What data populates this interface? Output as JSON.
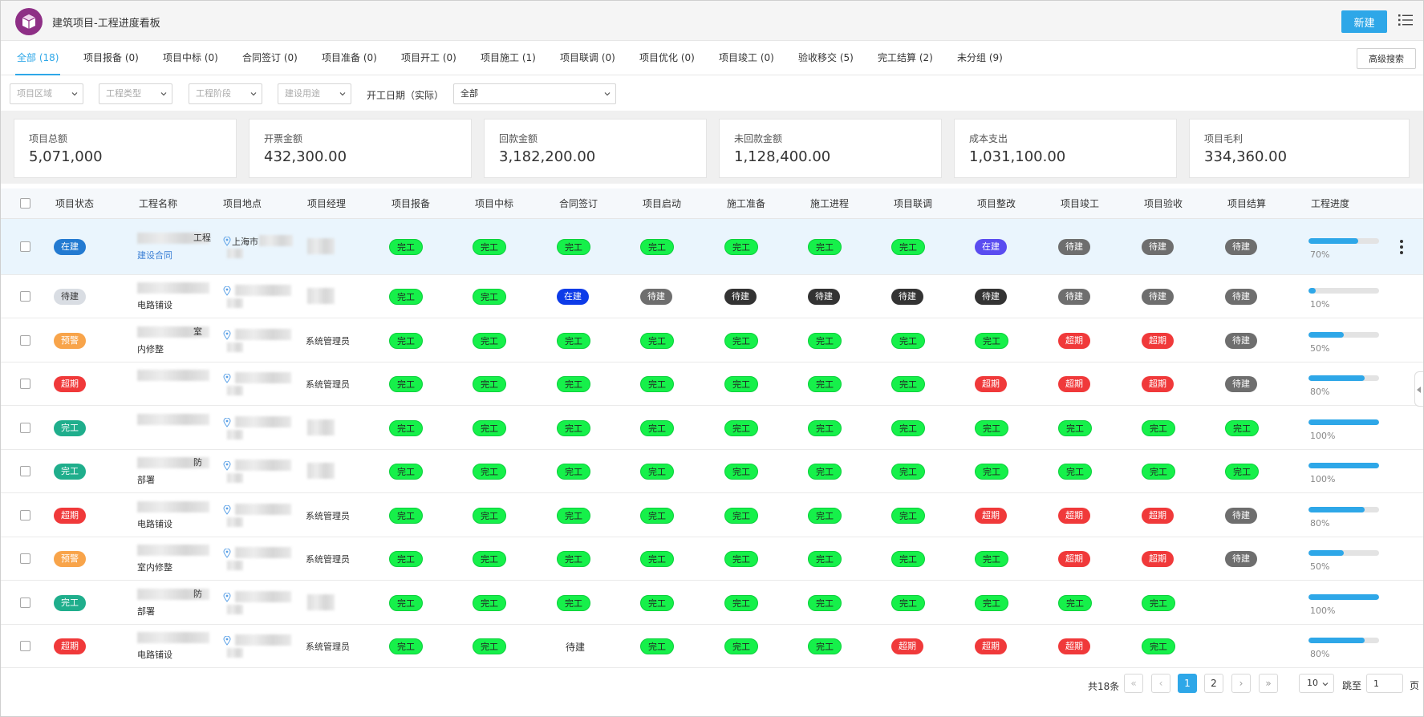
{
  "app": {
    "title": "建筑项目-工程进度看板",
    "new_label": "新建"
  },
  "tabs": [
    {
      "label": "全部 (18)",
      "active": true
    },
    {
      "label": "项目报备 (0)"
    },
    {
      "label": "项目中标 (0)"
    },
    {
      "label": "合同签订 (0)"
    },
    {
      "label": "项目准备 (0)"
    },
    {
      "label": "项目开工 (0)"
    },
    {
      "label": "项目施工 (1)"
    },
    {
      "label": "项目联调 (0)"
    },
    {
      "label": "项目优化 (0)"
    },
    {
      "label": "项目竣工 (0)"
    },
    {
      "label": "验收移交 (5)"
    },
    {
      "label": "完工结算 (2)"
    },
    {
      "label": "未分组 (9)"
    }
  ],
  "advanced_search": "高级搜索",
  "filters": {
    "region": "项目区域",
    "type": "工程类型",
    "stage": "工程阶段",
    "usage": "建设用途",
    "date_label": "开工日期（实际）",
    "date_value": "全部"
  },
  "stats": [
    {
      "label": "项目总额",
      "value": "5,071,000"
    },
    {
      "label": "开票金额",
      "value": "432,300.00"
    },
    {
      "label": "回款金额",
      "value": "3,182,200.00"
    },
    {
      "label": "未回款金额",
      "value": "1,128,400.00"
    },
    {
      "label": "成本支出",
      "value": "1,031,100.00"
    },
    {
      "label": "项目毛利",
      "value": "334,360.00"
    }
  ],
  "columns": [
    "项目状态",
    "工程名称",
    "项目地点",
    "项目经理",
    "项目报备",
    "项目中标",
    "合同签订",
    "项目启动",
    "施工准备",
    "施工进程",
    "项目联调",
    "项目整改",
    "项目竣工",
    "项目验收",
    "项目结算",
    "工程进度"
  ],
  "rows": [
    {
      "status": "在建",
      "status_color": "sblue",
      "name1": "工程",
      "name2": "建设合同",
      "name_link": true,
      "loc": "上海市",
      "mgr": "",
      "stages": [
        [
          "完工",
          "green"
        ],
        [
          "完工",
          "green"
        ],
        [
          "完工",
          "green"
        ],
        [
          "完工",
          "green"
        ],
        [
          "完工",
          "green"
        ],
        [
          "完工",
          "green"
        ],
        [
          "完工",
          "green"
        ],
        [
          "在建",
          "purple"
        ],
        [
          "待建",
          "grey"
        ],
        [
          "待建",
          "grey"
        ],
        [
          "待建",
          "grey"
        ]
      ],
      "progress": 70,
      "progress_label": "70%",
      "highlight": true
    },
    {
      "status": "待建",
      "status_color": "light",
      "name1": "",
      "name2": "电路铺设",
      "loc": "",
      "mgr": "",
      "stages": [
        [
          "完工",
          "green"
        ],
        [
          "完工",
          "green"
        ],
        [
          "在建",
          "blue"
        ],
        [
          "待建",
          "grey"
        ],
        [
          "待建",
          "dark"
        ],
        [
          "待建",
          "dark"
        ],
        [
          "待建",
          "dark"
        ],
        [
          "待建",
          "dark"
        ],
        [
          "待建",
          "grey"
        ],
        [
          "待建",
          "grey"
        ],
        [
          "待建",
          "grey"
        ]
      ],
      "progress": 10,
      "progress_label": "10%"
    },
    {
      "status": "预警",
      "status_color": "orange",
      "name1": "室",
      "name2": "内修整",
      "loc": "",
      "mgr": "系统管理员",
      "stages": [
        [
          "完工",
          "green"
        ],
        [
          "完工",
          "green"
        ],
        [
          "完工",
          "green"
        ],
        [
          "完工",
          "green"
        ],
        [
          "完工",
          "green"
        ],
        [
          "完工",
          "green"
        ],
        [
          "完工",
          "green"
        ],
        [
          "完工",
          "green"
        ],
        [
          "超期",
          "red"
        ],
        [
          "超期",
          "red"
        ],
        [
          "待建",
          "grey"
        ]
      ],
      "progress": 50,
      "progress_label": "50%"
    },
    {
      "status": "超期",
      "status_color": "red",
      "name1": "",
      "name2": "",
      "loc": "",
      "mgr": "系统管理员",
      "stages": [
        [
          "完工",
          "green"
        ],
        [
          "完工",
          "green"
        ],
        [
          "完工",
          "green"
        ],
        [
          "完工",
          "green"
        ],
        [
          "完工",
          "green"
        ],
        [
          "完工",
          "green"
        ],
        [
          "完工",
          "green"
        ],
        [
          "超期",
          "red"
        ],
        [
          "超期",
          "red"
        ],
        [
          "超期",
          "red"
        ],
        [
          "待建",
          "grey"
        ]
      ],
      "progress": 80,
      "progress_label": "80%"
    },
    {
      "status": "完工",
      "status_color": "teal",
      "name1": "",
      "name2": "",
      "loc": "",
      "mgr": "",
      "stages": [
        [
          "完工",
          "green"
        ],
        [
          "完工",
          "green"
        ],
        [
          "完工",
          "green"
        ],
        [
          "完工",
          "green"
        ],
        [
          "完工",
          "green"
        ],
        [
          "完工",
          "green"
        ],
        [
          "完工",
          "green"
        ],
        [
          "完工",
          "green"
        ],
        [
          "完工",
          "green"
        ],
        [
          "完工",
          "green"
        ],
        [
          "完工",
          "green"
        ]
      ],
      "progress": 100,
      "progress_label": "100%"
    },
    {
      "status": "完工",
      "status_color": "teal",
      "name1": "防",
      "name2": "部署",
      "loc": "",
      "mgr": "",
      "stages": [
        [
          "完工",
          "green"
        ],
        [
          "完工",
          "green"
        ],
        [
          "完工",
          "green"
        ],
        [
          "完工",
          "green"
        ],
        [
          "完工",
          "green"
        ],
        [
          "完工",
          "green"
        ],
        [
          "完工",
          "green"
        ],
        [
          "完工",
          "green"
        ],
        [
          "完工",
          "green"
        ],
        [
          "完工",
          "green"
        ],
        [
          "完工",
          "green"
        ]
      ],
      "progress": 100,
      "progress_label": "100%"
    },
    {
      "status": "超期",
      "status_color": "red",
      "name1": "",
      "name2": "电路铺设",
      "loc": "",
      "mgr": "系统管理员",
      "stages": [
        [
          "完工",
          "green"
        ],
        [
          "完工",
          "green"
        ],
        [
          "完工",
          "green"
        ],
        [
          "完工",
          "green"
        ],
        [
          "完工",
          "green"
        ],
        [
          "完工",
          "green"
        ],
        [
          "完工",
          "green"
        ],
        [
          "超期",
          "red"
        ],
        [
          "超期",
          "red"
        ],
        [
          "超期",
          "red"
        ],
        [
          "待建",
          "grey"
        ]
      ],
      "progress": 80,
      "progress_label": "80%"
    },
    {
      "status": "预警",
      "status_color": "orange",
      "name1": "",
      "name2": "室内修整",
      "loc": "",
      "mgr": "系统管理员",
      "stages": [
        [
          "完工",
          "green"
        ],
        [
          "完工",
          "green"
        ],
        [
          "完工",
          "green"
        ],
        [
          "完工",
          "green"
        ],
        [
          "完工",
          "green"
        ],
        [
          "完工",
          "green"
        ],
        [
          "完工",
          "green"
        ],
        [
          "完工",
          "green"
        ],
        [
          "超期",
          "red"
        ],
        [
          "超期",
          "red"
        ],
        [
          "待建",
          "grey"
        ]
      ],
      "progress": 50,
      "progress_label": "50%"
    },
    {
      "status": "完工",
      "status_color": "teal",
      "name1": "防",
      "name2": "部署",
      "loc": "",
      "mgr": "",
      "stages": [
        [
          "完工",
          "green"
        ],
        [
          "完工",
          "green"
        ],
        [
          "完工",
          "green"
        ],
        [
          "完工",
          "green"
        ],
        [
          "完工",
          "green"
        ],
        [
          "完工",
          "green"
        ],
        [
          "完工",
          "green"
        ],
        [
          "完工",
          "green"
        ],
        [
          "完工",
          "green"
        ],
        [
          "完工",
          "green"
        ],
        [
          "",
          ""
        ]
      ],
      "progress": 100,
      "progress_label": "100%"
    },
    {
      "status": "超期",
      "status_color": "red",
      "name1": "",
      "name2": "电路铺设",
      "loc": "",
      "mgr": "系统管理员",
      "stages": [
        [
          "完工",
          "green"
        ],
        [
          "完工",
          "green"
        ],
        [
          "待建",
          "plain"
        ],
        [
          "完工",
          "green"
        ],
        [
          "完工",
          "green"
        ],
        [
          "完工",
          "green"
        ],
        [
          "超期",
          "red"
        ],
        [
          "超期",
          "red"
        ],
        [
          "超期",
          "red"
        ],
        [
          "完工",
          "green"
        ],
        [
          "",
          ""
        ]
      ],
      "progress": 80,
      "progress_label": "80%"
    }
  ],
  "pager": {
    "total": "共18条",
    "pages": [
      "1",
      "2"
    ],
    "size": "10",
    "jump_label": "跳至",
    "jump_value": "1",
    "page_suffix": "页"
  }
}
